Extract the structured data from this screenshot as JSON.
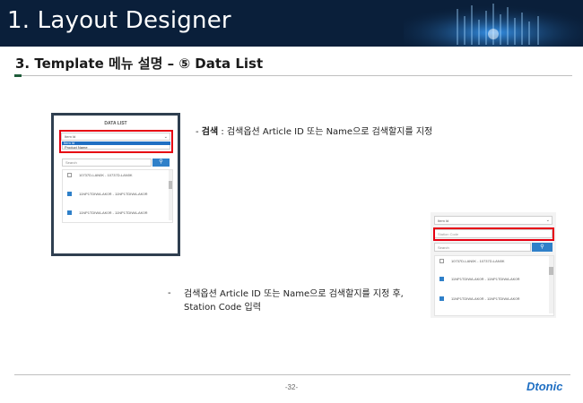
{
  "header": {
    "title": "1. Layout Designer"
  },
  "subtitle": "3.  Template 메뉴 설명 – ⑤ Data List",
  "screenshot1": {
    "title": "DATA LIST",
    "select_value": "Item Id",
    "options": [
      "Item Id",
      "Product Name"
    ],
    "search_placeholder": "Search",
    "rows": [
      {
        "text": "10737D-LAN0K - 10737D-LAN0K",
        "checked": false
      },
      {
        "text": "11NP1TDIWA-AK0R - 11NP1TDIWA-AK0R",
        "checked": true
      },
      {
        "text": "11NP1TDIWA-AK0R - 11NP1TDIWA-AK0R",
        "checked": true
      }
    ]
  },
  "desc1": {
    "bold": "검색",
    "rest": " : 검색옵션 Article ID 또는 Name으로 검색할지를 지정"
  },
  "desc2": {
    "dash": "-",
    "text": "검색옵션 Article ID 또는 Name으로 검색할지를 지정 후, Station Code 입력"
  },
  "screenshot2": {
    "select_value": "Item Id",
    "station_placeholder": "Station Code",
    "search_placeholder": "Search",
    "rows": [
      {
        "text": "10737D-LAN0K - 10737D-LAN0K",
        "checked": false
      },
      {
        "text": "11NP1TDIWA-AK0R - 11NP1TDIWA-AK0R",
        "checked": true
      },
      {
        "text": "11NP1TDIWA-AK0R - 11NP1TDIWA-AK0R",
        "checked": true
      }
    ]
  },
  "footer": {
    "page": "-32-",
    "logo": "Dtonic"
  },
  "colors": {
    "header_bg": "#0a1f3a",
    "highlight": "#e60012",
    "accent": "#2f80c9"
  },
  "icons": {
    "search": "search-icon",
    "dropdown": "chevron-down-icon"
  }
}
